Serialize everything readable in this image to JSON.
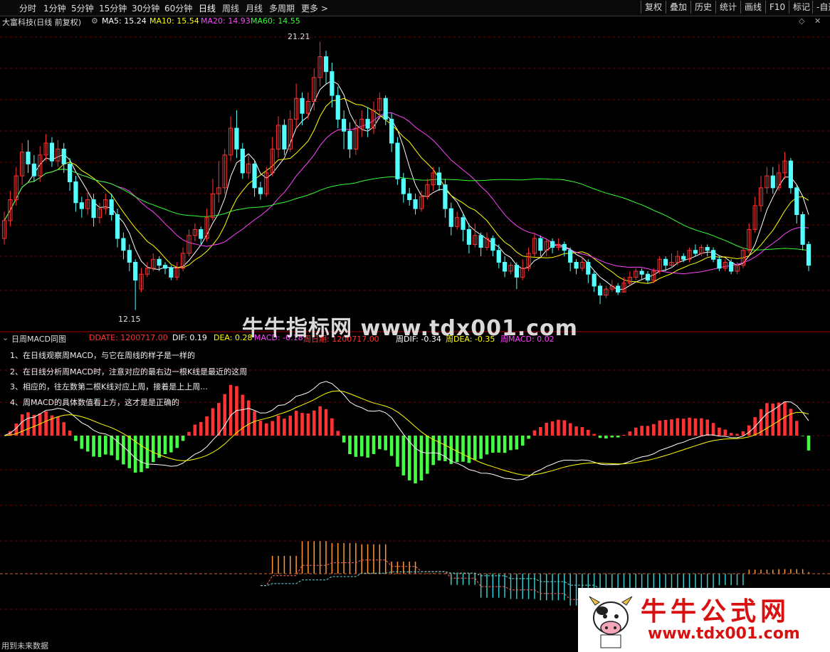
{
  "toolbar": {
    "periods": [
      "分时",
      "1分钟",
      "5分钟",
      "15分钟",
      "30分钟",
      "60分钟",
      "日线",
      "周线",
      "月线",
      "多周期",
      "更多 >"
    ],
    "active_period": "日线",
    "right_buttons": [
      "复权",
      "叠加",
      "历史",
      "统计",
      "画线",
      "F10",
      "标记",
      "-自选"
    ]
  },
  "main_chart": {
    "stock_title": "大富科技(日线 前复权)",
    "ma": [
      {
        "label": "MA5: 15.24",
        "color": "#ffffff"
      },
      {
        "label": "MA10: 15.54",
        "color": "#ffff00"
      },
      {
        "label": "MA20: 14.93",
        "color": "#ff44ff"
      },
      {
        "label": "MA60: 14.55",
        "color": "#33ff33"
      }
    ],
    "high_label": "21.21",
    "low_label": "12.15",
    "candles": [
      [
        14.6,
        15.2,
        14.4,
        15.5
      ],
      [
        15.2,
        15.9,
        15.0,
        16.2
      ],
      [
        15.9,
        16.7,
        15.7,
        17.0
      ],
      [
        16.7,
        17.5,
        16.4,
        17.8
      ],
      [
        17.5,
        17.1,
        16.8,
        17.9
      ],
      [
        17.1,
        16.7,
        16.5,
        17.4
      ],
      [
        16.7,
        17.4,
        16.5,
        17.7
      ],
      [
        17.4,
        17.8,
        17.2,
        18.1
      ],
      [
        17.8,
        17.2,
        17.0,
        18.0
      ],
      [
        17.2,
        17.6,
        17.0,
        17.9
      ],
      [
        17.6,
        17.1,
        16.8,
        17.8
      ],
      [
        17.1,
        16.5,
        16.2,
        17.3
      ],
      [
        16.5,
        15.8,
        15.5,
        16.7
      ],
      [
        15.8,
        15.6,
        15.3,
        16.0
      ],
      [
        15.6,
        15.9,
        15.4,
        16.2
      ],
      [
        15.9,
        15.3,
        15.0,
        16.1
      ],
      [
        15.3,
        15.6,
        15.1,
        15.8
      ],
      [
        15.6,
        15.9,
        15.4,
        16.1
      ],
      [
        15.9,
        15.4,
        15.2,
        16.1
      ],
      [
        15.4,
        14.6,
        14.3,
        15.6
      ],
      [
        14.6,
        14.2,
        13.9,
        14.8
      ],
      [
        14.2,
        13.8,
        13.5,
        14.4
      ],
      [
        13.8,
        13.2,
        12.2,
        13.9
      ],
      [
        12.9,
        13.4,
        12.8,
        13.6
      ],
      [
        13.4,
        13.6,
        13.3,
        13.8
      ],
      [
        13.6,
        13.9,
        13.5,
        14.1
      ],
      [
        13.9,
        13.7,
        13.5,
        14.0
      ],
      [
        13.7,
        13.6,
        13.4,
        13.8
      ],
      [
        13.6,
        13.3,
        13.2,
        13.7
      ],
      [
        13.3,
        13.6,
        13.2,
        13.8
      ],
      [
        13.6,
        14.1,
        13.5,
        14.3
      ],
      [
        14.1,
        14.7,
        14.0,
        14.9
      ],
      [
        14.7,
        14.9,
        14.5,
        15.1
      ],
      [
        14.9,
        14.6,
        14.4,
        15.0
      ],
      [
        14.6,
        15.3,
        14.5,
        15.6
      ],
      [
        15.3,
        16.1,
        15.2,
        16.6
      ],
      [
        16.1,
        16.3,
        15.8,
        17.2
      ],
      [
        16.3,
        17.4,
        16.1,
        17.6
      ],
      [
        17.4,
        18.3,
        17.2,
        18.7
      ],
      [
        18.3,
        17.6,
        17.3,
        18.9
      ],
      [
        17.6,
        16.8,
        16.6,
        17.8
      ],
      [
        16.8,
        17.1,
        16.6,
        17.4
      ],
      [
        17.1,
        16.3,
        16.0,
        17.2
      ],
      [
        16.3,
        16.1,
        15.9,
        16.5
      ],
      [
        16.1,
        16.8,
        16.0,
        17.0
      ],
      [
        16.8,
        17.6,
        16.7,
        18.0
      ],
      [
        17.6,
        18.4,
        17.3,
        18.7
      ],
      [
        18.4,
        17.6,
        17.4,
        18.6
      ],
      [
        17.6,
        18.6,
        17.5,
        18.9
      ],
      [
        18.6,
        19.3,
        18.3,
        19.8
      ],
      [
        19.3,
        18.8,
        18.4,
        19.5
      ],
      [
        18.8,
        19.2,
        18.6,
        19.5
      ],
      [
        19.2,
        20.0,
        18.9,
        20.3
      ],
      [
        20.0,
        20.7,
        19.7,
        21.21
      ],
      [
        20.7,
        20.2,
        19.8,
        20.9
      ],
      [
        20.2,
        19.4,
        19.0,
        20.5
      ],
      [
        19.4,
        18.6,
        18.3,
        19.7
      ],
      [
        18.6,
        18.2,
        17.6,
        18.9
      ],
      [
        18.2,
        17.6,
        17.3,
        18.5
      ],
      [
        17.6,
        18.3,
        17.4,
        18.6
      ],
      [
        18.3,
        18.6,
        18.0,
        18.9
      ],
      [
        18.6,
        18.3,
        18.0,
        19.0
      ],
      [
        18.3,
        18.9,
        18.1,
        19.2
      ],
      [
        18.9,
        19.3,
        18.6,
        19.5
      ],
      [
        19.3,
        18.6,
        18.4,
        19.4
      ],
      [
        18.6,
        17.8,
        17.5,
        18.8
      ],
      [
        17.8,
        16.6,
        16.4,
        18.0
      ],
      [
        16.6,
        16.1,
        15.8,
        16.8
      ],
      [
        16.1,
        15.9,
        15.7,
        16.3
      ],
      [
        15.9,
        15.6,
        15.4,
        16.1
      ],
      [
        15.6,
        16.0,
        15.5,
        16.2
      ],
      [
        16.0,
        16.4,
        15.9,
        16.6
      ],
      [
        16.4,
        16.8,
        16.2,
        17.0
      ],
      [
        16.8,
        16.4,
        16.2,
        17.0
      ],
      [
        16.4,
        15.6,
        15.3,
        16.6
      ],
      [
        15.6,
        15.0,
        14.7,
        15.8
      ],
      [
        15.0,
        15.3,
        14.9,
        15.5
      ],
      [
        15.3,
        14.9,
        14.5,
        15.4
      ],
      [
        14.9,
        14.4,
        14.1,
        15.1
      ],
      [
        14.4,
        14.7,
        14.3,
        15.1
      ],
      [
        14.7,
        14.3,
        14.0,
        14.8
      ],
      [
        14.3,
        14.6,
        14.2,
        14.8
      ],
      [
        14.6,
        14.2,
        14.0,
        14.7
      ],
      [
        14.2,
        13.8,
        13.6,
        14.4
      ],
      [
        13.8,
        13.5,
        13.3,
        14.0
      ],
      [
        13.5,
        13.7,
        13.4,
        13.8
      ],
      [
        13.7,
        13.3,
        12.9,
        13.8
      ],
      [
        13.3,
        13.6,
        13.2,
        13.9
      ],
      [
        13.6,
        14.1,
        13.5,
        14.3
      ],
      [
        14.1,
        14.6,
        14.0,
        14.8
      ],
      [
        14.6,
        14.2,
        14.0,
        14.7
      ],
      [
        14.2,
        14.5,
        14.0,
        14.6
      ],
      [
        14.5,
        14.3,
        14.1,
        14.6
      ],
      [
        14.3,
        14.4,
        14.2,
        14.6
      ],
      [
        14.4,
        14.2,
        14.0,
        14.5
      ],
      [
        14.2,
        13.8,
        13.5,
        14.3
      ],
      [
        13.8,
        13.6,
        13.4,
        13.9
      ],
      [
        13.6,
        13.8,
        13.5,
        14.0
      ],
      [
        13.8,
        13.4,
        13.1,
        13.9
      ],
      [
        13.4,
        13.0,
        12.8,
        13.5
      ],
      [
        13.0,
        12.7,
        12.4,
        13.1
      ],
      [
        12.7,
        12.9,
        12.6,
        13.0
      ],
      [
        12.9,
        13.0,
        12.8,
        13.2
      ],
      [
        13.0,
        12.8,
        12.7,
        13.1
      ],
      [
        12.8,
        13.1,
        12.8,
        13.3
      ],
      [
        13.1,
        13.3,
        13.0,
        13.5
      ],
      [
        13.3,
        13.5,
        13.2,
        13.6
      ],
      [
        13.5,
        13.4,
        13.2,
        13.6
      ],
      [
        13.4,
        13.2,
        13.1,
        13.5
      ],
      [
        13.2,
        13.5,
        13.1,
        13.6
      ],
      [
        13.5,
        13.9,
        13.4,
        14.0
      ],
      [
        13.9,
        13.7,
        13.5,
        14.0
      ],
      [
        13.7,
        13.8,
        13.6,
        14.1
      ],
      [
        13.8,
        14.0,
        13.7,
        14.2
      ],
      [
        14.0,
        13.9,
        13.8,
        14.1
      ],
      [
        13.9,
        14.2,
        13.8,
        14.3
      ],
      [
        14.2,
        14.1,
        14.0,
        14.4
      ],
      [
        14.1,
        14.3,
        14.0,
        14.4
      ],
      [
        14.3,
        14.2,
        14.0,
        14.4
      ],
      [
        14.2,
        13.9,
        13.8,
        14.3
      ],
      [
        13.9,
        13.6,
        13.5,
        14.0
      ],
      [
        13.6,
        13.8,
        13.5,
        13.9
      ],
      [
        13.8,
        13.5,
        13.4,
        13.9
      ],
      [
        13.5,
        13.7,
        13.4,
        13.8
      ],
      [
        13.7,
        14.2,
        13.6,
        14.3
      ],
      [
        14.2,
        14.9,
        14.1,
        15.1
      ],
      [
        14.9,
        15.7,
        14.8,
        16.0
      ],
      [
        15.7,
        16.3,
        15.5,
        16.7
      ],
      [
        16.3,
        16.7,
        16.1,
        17.0
      ],
      [
        16.7,
        16.3,
        16.1,
        17.0
      ],
      [
        16.3,
        16.8,
        16.2,
        17.1
      ],
      [
        16.8,
        17.2,
        16.6,
        17.5
      ],
      [
        17.2,
        16.3,
        16.1,
        17.3
      ],
      [
        16.3,
        15.4,
        15.1,
        16.4
      ],
      [
        15.4,
        14.4,
        14.2,
        15.5
      ],
      [
        14.4,
        13.7,
        13.5,
        14.5
      ]
    ]
  },
  "indicator": {
    "title": "日周MACD同图",
    "values": [
      {
        "text": "DDATE: 1200717.00",
        "color": "#ff3333"
      },
      {
        "text": "DIF: 0.19",
        "color": "#ffffff"
      },
      {
        "text": "DEA: 0.28",
        "color": "#ffff00"
      },
      {
        "text": "MACD: -0.18",
        "color": "#ff44ff"
      },
      {
        "text": "周日期: 1200717.00",
        "color": "#ff3333"
      },
      {
        "text": "周DIF: -0.34",
        "color": "#ffffff"
      },
      {
        "text": "周DEA: -0.35",
        "color": "#ffff00"
      },
      {
        "text": "周MACD: 0.02",
        "color": "#ff44ff"
      }
    ],
    "notes": [
      "1、在日线观察周MACD，与它在周线的样子是一样的",
      "2、在日线分析周MACD时，注意对应的最右边一根K线是最近的这周",
      "3、相应的，往左数第二根K线对应上周，接着是上上周...",
      "4、周MACD的具体数值看上方，这才是是正确的"
    ]
  },
  "watermark": {
    "text": "牛牛指标网 www.tdx001.com",
    "brand_title": "牛牛公式网",
    "brand_url": "www.tdx001.com"
  },
  "footer": "用到未来数据",
  "colors": {
    "up": "#ff3333",
    "down": "#55ffff",
    "ma5": "#ffffff",
    "ma10": "#ffff00",
    "ma20": "#ff44ff",
    "ma60": "#33ff33",
    "hist_pos": "#ff3333",
    "hist_neg": "#44ff44",
    "week_pos": "#ff9933",
    "week_neg": "#33cccc"
  }
}
